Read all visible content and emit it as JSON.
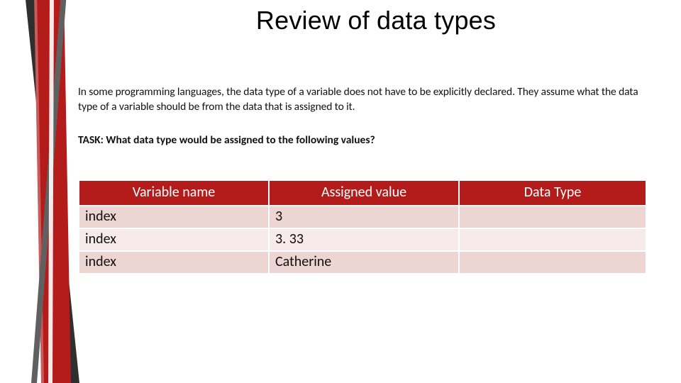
{
  "title": "Review of data types",
  "paragraph": "In some programming languages, the data type of a variable does not have to be explicitly declared. They assume what the data type of a variable should be from the data that is assigned to it.",
  "task": "TASK: What data type would be assigned to the following values?",
  "table": {
    "headers": [
      "Variable name",
      "Assigned value",
      "Data Type"
    ],
    "rows": [
      {
        "var": "index",
        "val": "3",
        "type": ""
      },
      {
        "var": "index",
        "val": "3. 33",
        "type": ""
      },
      {
        "var": "index",
        "val": "Catherine",
        "type": ""
      }
    ]
  },
  "colors": {
    "accent": "#b41c1c",
    "row_odd": "#ecd5d3",
    "row_even": "#f6ebea"
  }
}
